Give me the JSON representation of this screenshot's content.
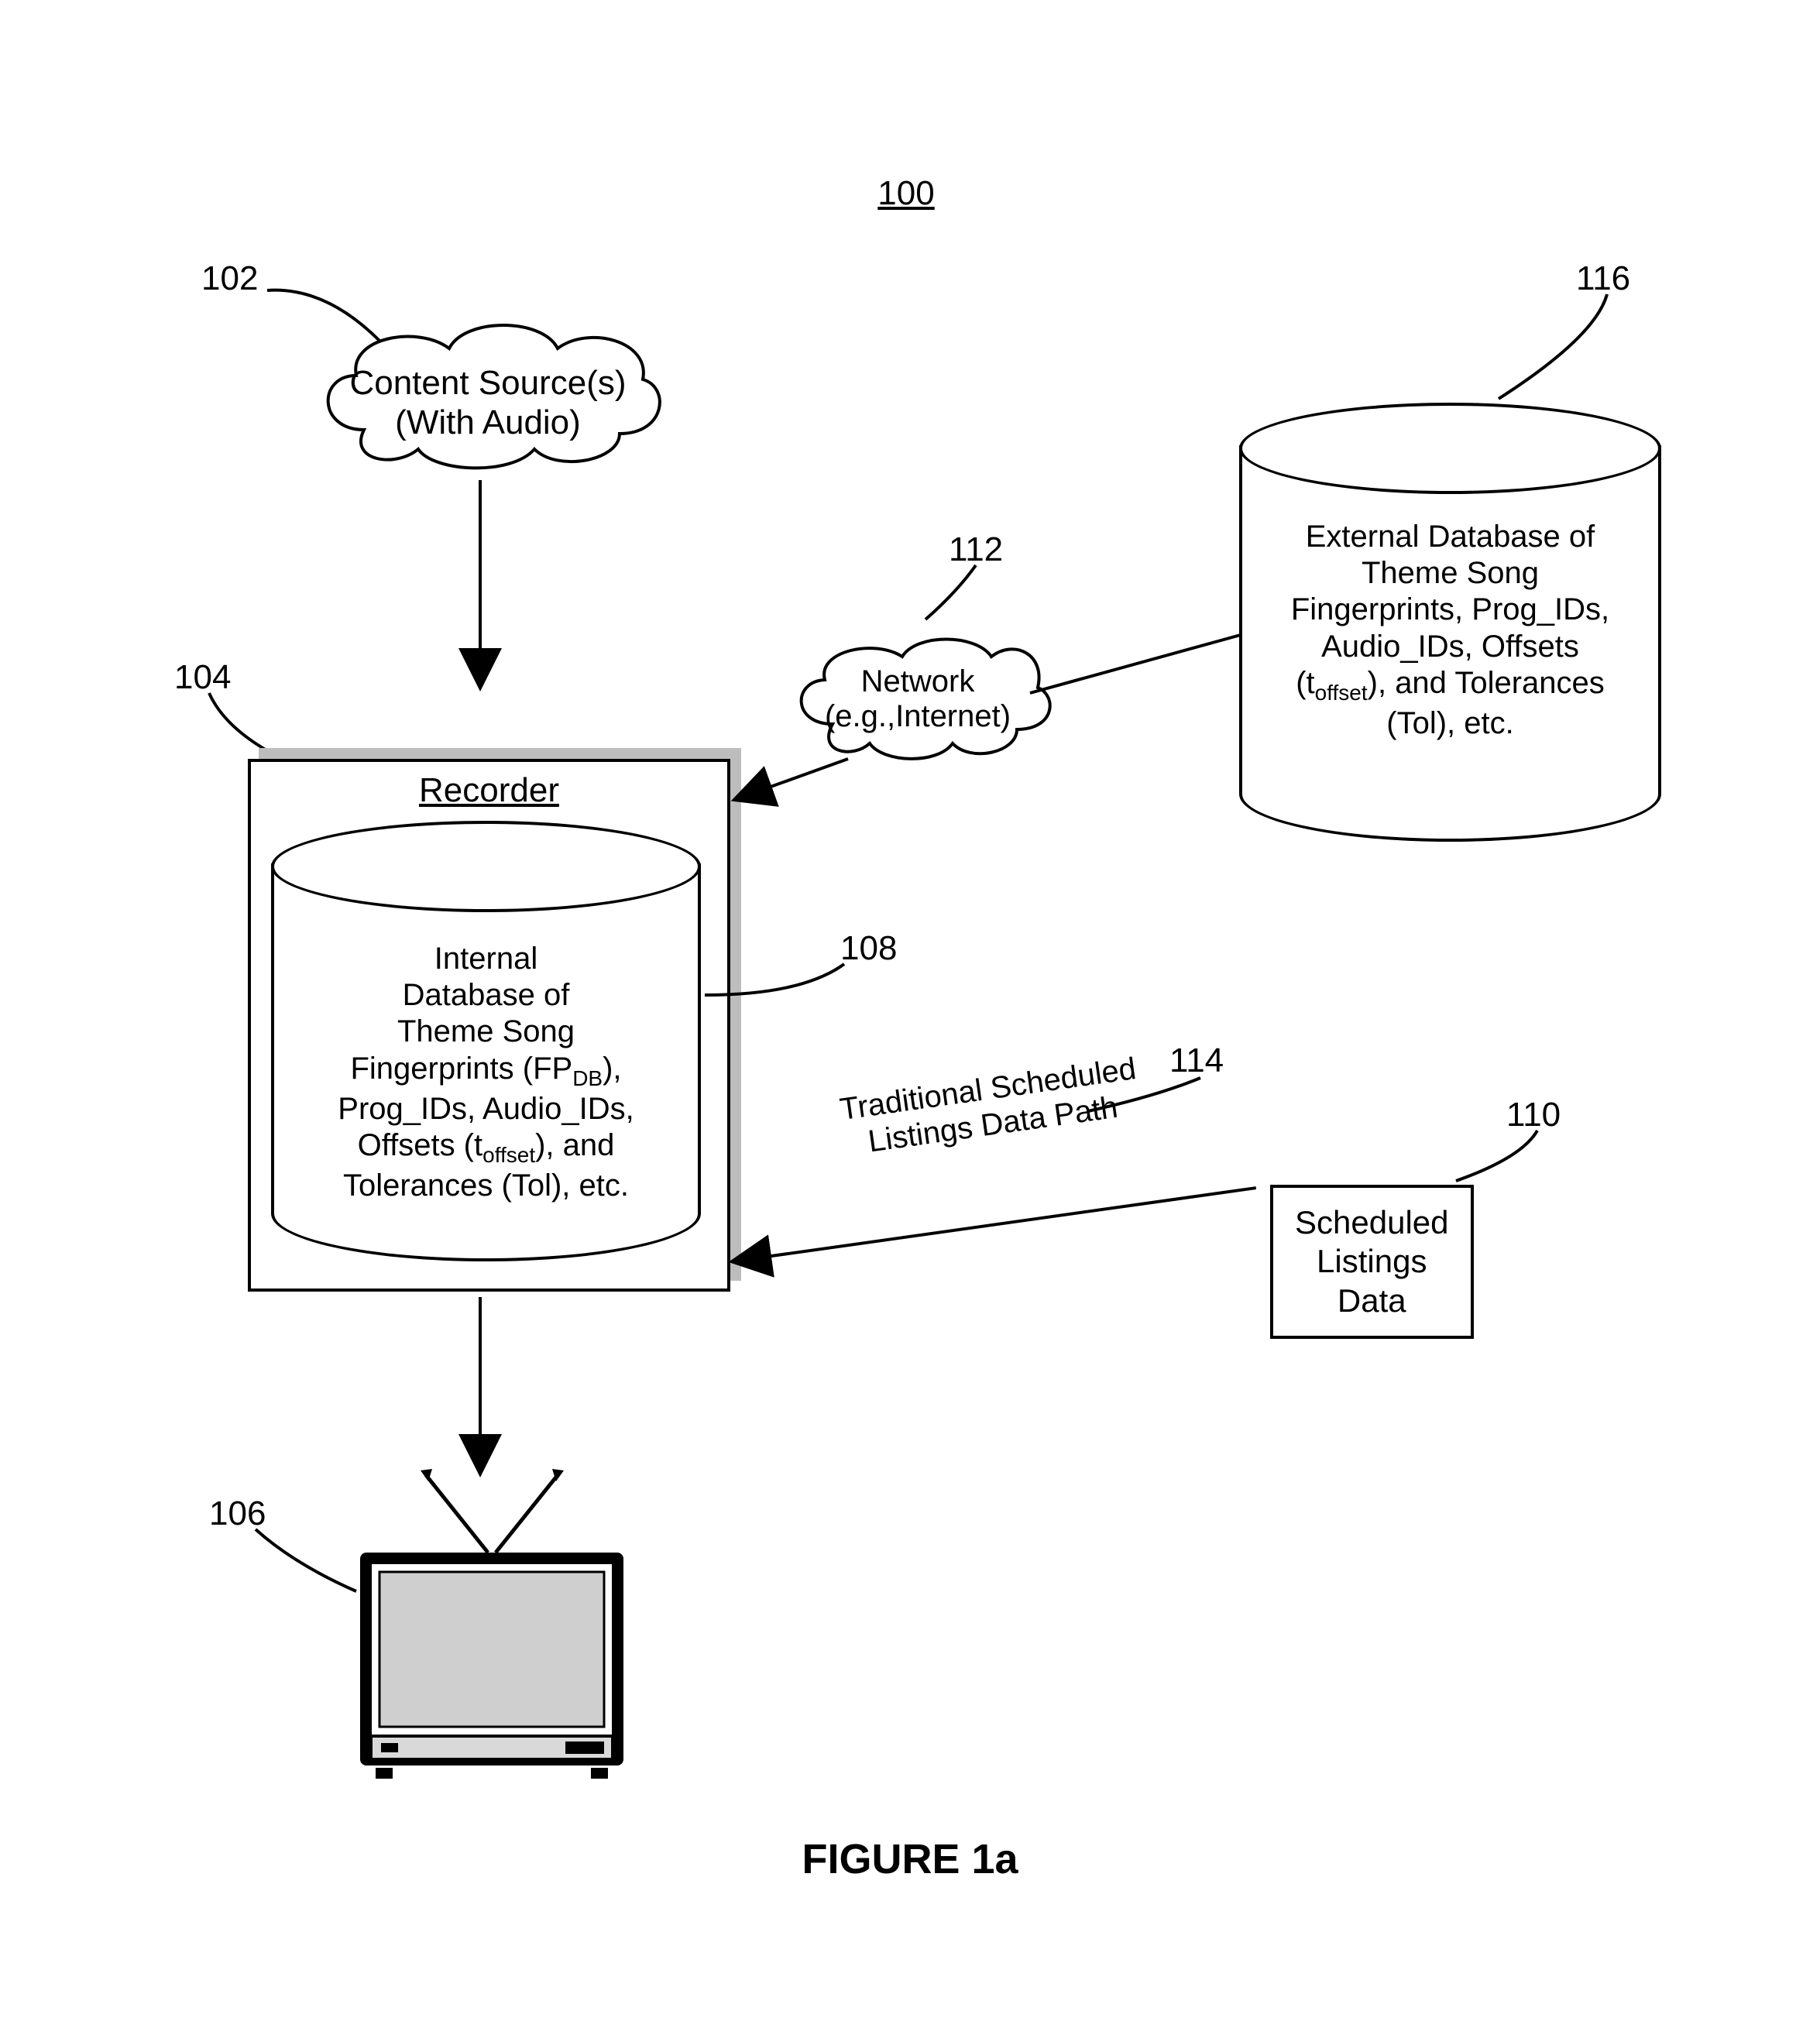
{
  "figure": {
    "ref": "100",
    "title": "FIGURE 1a"
  },
  "refs": {
    "r102": "102",
    "r104": "104",
    "r106": "106",
    "r108": "108",
    "r110": "110",
    "r112": "112",
    "r114": "114",
    "r116": "116"
  },
  "nodes": {
    "content_source": {
      "line1": "Content Source(s)",
      "line2": "(With Audio)"
    },
    "network": {
      "line1": "Network",
      "line2": "(e.g.,Internet)"
    },
    "recorder": {
      "title": "Recorder"
    },
    "internal_db": {
      "l1": "Internal",
      "l2": "Database of",
      "l3": "Theme Song",
      "l4_a": "Fingerprints (FP",
      "l4_sub": "DB",
      "l4_b": "),",
      "l5": "Prog_IDs, Audio_IDs,",
      "l6_a": "Offsets (t",
      "l6_sub": "offset",
      "l6_b": "), and",
      "l7": "Tolerances (Tol), etc."
    },
    "external_db": {
      "l1": "External Database of",
      "l2": "Theme Song",
      "l3": "Fingerprints, Prog_IDs,",
      "l4": "Audio_IDs, Offsets",
      "l5_a": "(t",
      "l5_sub": "offset",
      "l5_b": "), and Tolerances",
      "l6": "(Tol), etc."
    },
    "scheduled_listings": {
      "l1": "Scheduled",
      "l2": "Listings",
      "l3": "Data"
    }
  },
  "edges": {
    "trad_path": {
      "l1": "Traditional Scheduled",
      "l2": "Listings Data Path"
    }
  }
}
